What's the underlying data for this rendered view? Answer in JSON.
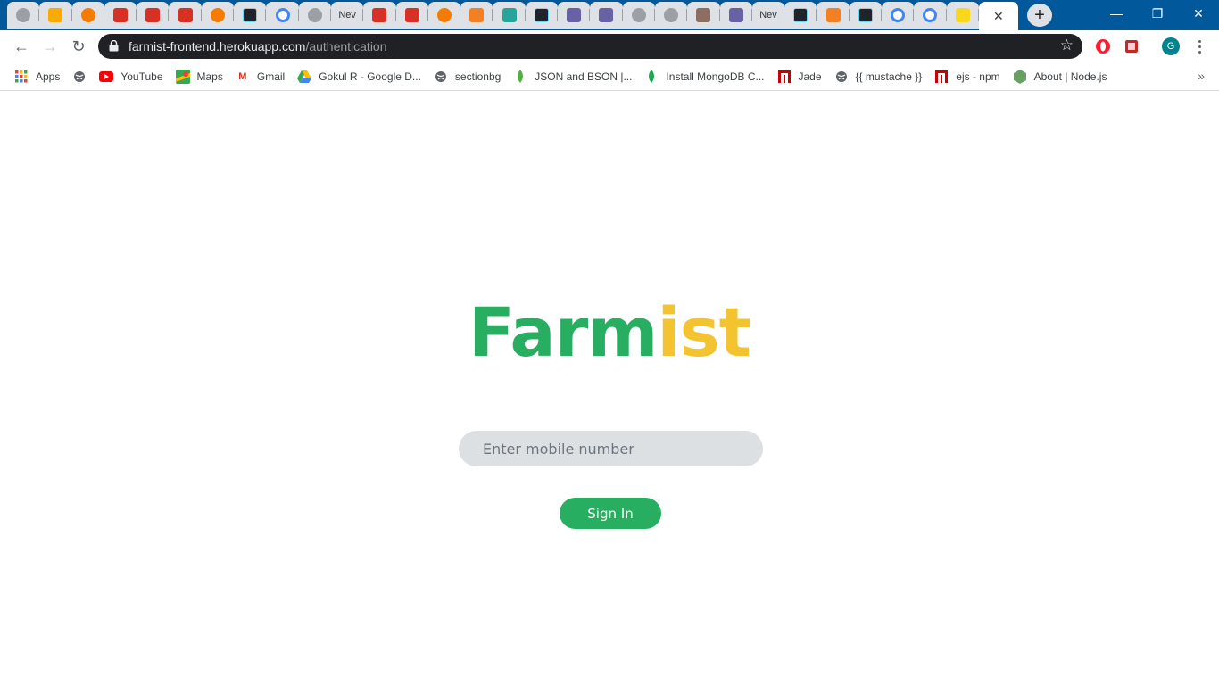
{
  "browser": {
    "tabs": [
      {
        "icon": "globe-icon",
        "color": "#9aa0a6"
      },
      {
        "icon": "drive-bolt-icon",
        "color": "#f9ab00"
      },
      {
        "icon": "sun-icon",
        "color": "#f57c00"
      },
      {
        "icon": "gmail-icon",
        "color": "#d93025"
      },
      {
        "icon": "gmail-icon",
        "color": "#d93025"
      },
      {
        "icon": "gmail-icon",
        "color": "#d93025"
      },
      {
        "icon": "sun-icon",
        "color": "#f57c00"
      },
      {
        "icon": "react-icon",
        "color": "#61dafb"
      },
      {
        "icon": "google-icon",
        "color": "#4285f4"
      },
      {
        "icon": "globe-icon",
        "color": "#9aa0a6"
      },
      {
        "icon": "text-icon",
        "text": "Nev"
      },
      {
        "icon": "gmail-icon",
        "color": "#d93025"
      },
      {
        "icon": "gmail-icon",
        "color": "#d93025"
      },
      {
        "icon": "sun-icon",
        "color": "#f57c00"
      },
      {
        "icon": "stackoverflow-icon",
        "color": "#f48024"
      },
      {
        "icon": "diamond-icon",
        "color": "#26a69a"
      },
      {
        "icon": "react-icon",
        "color": "#61dafb"
      },
      {
        "icon": "heroku-icon",
        "color": "#6762a6"
      },
      {
        "icon": "heroku-icon",
        "color": "#6762a6"
      },
      {
        "icon": "globe-icon",
        "color": "#9aa0a6"
      },
      {
        "icon": "globe-icon",
        "color": "#9aa0a6"
      },
      {
        "icon": "monkey-icon",
        "color": "#8d6e63"
      },
      {
        "icon": "heroku-icon",
        "color": "#6762a6"
      },
      {
        "icon": "text-icon",
        "text": "Nev"
      },
      {
        "icon": "react-icon",
        "color": "#61dafb"
      },
      {
        "icon": "stackoverflow-icon",
        "color": "#f48024"
      },
      {
        "icon": "react-icon",
        "color": "#61dafb"
      },
      {
        "icon": "google-icon",
        "color": "#4285f4"
      },
      {
        "icon": "google-icon",
        "color": "#4285f4"
      },
      {
        "icon": "flipkart-icon",
        "color": "#f9d71c"
      }
    ],
    "url": {
      "host": "farmist-frontend.herokuapp.com",
      "path": "/authentication"
    },
    "profile_initial": "G",
    "bookmarks": [
      {
        "label": "Apps",
        "icon": "apps-grid-icon",
        "color": "#ea4335"
      },
      {
        "label": "",
        "icon": "globe-icon",
        "color": "#5f6368"
      },
      {
        "label": "YouTube",
        "icon": "youtube-icon",
        "color": "#ff0000"
      },
      {
        "label": "Maps",
        "icon": "maps-icon",
        "color": "#34a853"
      },
      {
        "label": "Gmail",
        "icon": "gmail-icon",
        "color": "#d93025"
      },
      {
        "label": "Gokul R - Google D...",
        "icon": "drive-icon",
        "color": "#fbbc04"
      },
      {
        "label": "sectionbg",
        "icon": "globe-icon",
        "color": "#5f6368"
      },
      {
        "label": "JSON and BSON |...",
        "icon": "mongodb-leaf-icon",
        "color": "#4db33d"
      },
      {
        "label": "Install MongoDB C...",
        "icon": "mongodb-leaf-icon",
        "color": "#13aa52"
      },
      {
        "label": "Jade",
        "icon": "npm-icon",
        "color": "#cb0000"
      },
      {
        "label": "{{ mustache }}",
        "icon": "globe-icon",
        "color": "#5f6368"
      },
      {
        "label": "ejs - npm",
        "icon": "npm-icon",
        "color": "#cb0000"
      },
      {
        "label": "About | Node.js",
        "icon": "nodejs-icon",
        "color": "#68a063"
      }
    ]
  },
  "page": {
    "logo": {
      "part1": "Farm",
      "part2": "ist"
    },
    "mobile_placeholder": "Enter mobile number",
    "signin_label": "Sign In"
  },
  "colors": {
    "brand_green": "#27ae60",
    "brand_yellow": "#f4c430",
    "tabstrip": "#01589a",
    "input_bg": "#dde0e3"
  }
}
